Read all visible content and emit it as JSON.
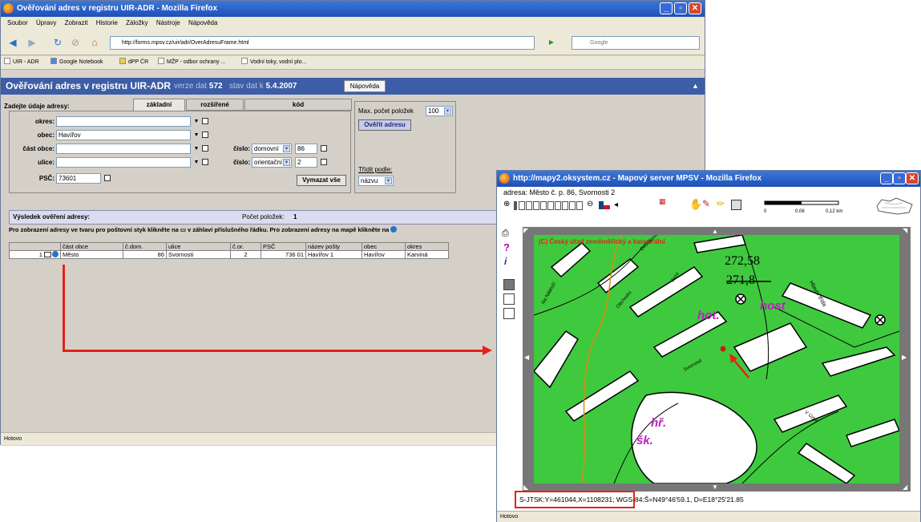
{
  "main_window": {
    "title": "Ověřování adres v registru UIR-ADR - Mozilla Firefox",
    "menu": [
      "Soubor",
      "Úpravy",
      "Zobrazit",
      "Historie",
      "Záložky",
      "Nástroje",
      "Nápověda"
    ],
    "url": "http://forms.mpsv.cz/uir/adr/OverAdresuFrame.html",
    "search_placeholder": "Google",
    "bookmarks": [
      "UIR - ADR",
      "Google Notebook",
      "dPP ČR",
      "MŽP - odbor ochrany ...",
      "Vodní toky, vodní plo..."
    ],
    "status": "Hotovo"
  },
  "app": {
    "title": "Ověřování adres v registru UIR-ADR",
    "version_label": "verze dat",
    "version": "572",
    "state_label": "stav dat k",
    "state_date": "5.4.2007",
    "help_button": "Nápověda"
  },
  "form": {
    "heading": "Zadejte údaje adresy:",
    "tabs": [
      "základní",
      "rozšířené",
      "kód"
    ],
    "labels": {
      "okres": "okres:",
      "obec": "obec:",
      "cast_obce": "část obce:",
      "ulice": "ulice:",
      "psc": "PSČ:",
      "cislo": "číslo:"
    },
    "values": {
      "okres": "",
      "obec": "Havířov",
      "cast_obce": "",
      "ulice": "",
      "psc": "73601"
    },
    "cislo_dom_type": "domovní",
    "cislo_dom": "86",
    "cislo_or_type": "orientační",
    "cislo_or": "2",
    "clear_button": "Vymazat vše",
    "max_label": "Max. počet položek",
    "max_value": "100",
    "verify_button": "Ověřit adresu",
    "sort_label": "Třídit podle:",
    "sort_value": "názvu"
  },
  "results": {
    "heading": "Výsledek ověření adresy:",
    "count_label": "Počet položek:",
    "count": "1",
    "hint": "Pro zobrazení adresy ve tvaru pro poštovní styk klikněte na ▭ v záhlaví příslušného řádku. Pro zobrazení adresy na mapě klikněte na",
    "columns": [
      "část obce",
      "č.dom.",
      "ulice",
      "č.or.",
      "PSČ",
      "název pošty",
      "obec",
      "okres"
    ],
    "rows": [
      [
        "1",
        "Město",
        "86",
        "Svornosti",
        "2",
        "736 01",
        "Havířov 1",
        "Havířov",
        "Karviná"
      ]
    ]
  },
  "map_window": {
    "title": "http://mapy2.oksystem.cz - Mapový server MPSV - Mozilla Firefox",
    "address": "adresa: Město č. p. 86, Svornosti 2",
    "scale_labels": [
      "0",
      "0,06",
      "0,12 km"
    ],
    "copyright": "(C) Český úřad zeměměřický a katastrální",
    "labels": {
      "height1": "272,58",
      "height2": "271,8",
      "hot": "hot.",
      "host": "host",
      "hr": "hř.",
      "sk": "šk.",
      "hlavni": "Hlavní třída",
      "obchodni": "Obchodní",
      "svornosti": "Svornosti",
      "resident": "Na Nábřeží",
      "jara": "Jarní",
      "dvorak": "Dvořákova",
      "uzka": "V Úzké"
    },
    "coords_jtsk": "S-JTSK:Y=461044,X=1108231",
    "coords_wgs": "; WGS-84:Š=N49°46'59.1, D=E18°25'21.85",
    "status": "Hotovo"
  },
  "colors": {
    "titlebar": "#2456c6",
    "appbar": "#3d5da6",
    "map_green": "#3fc93f",
    "arrow": "#e8201a"
  }
}
